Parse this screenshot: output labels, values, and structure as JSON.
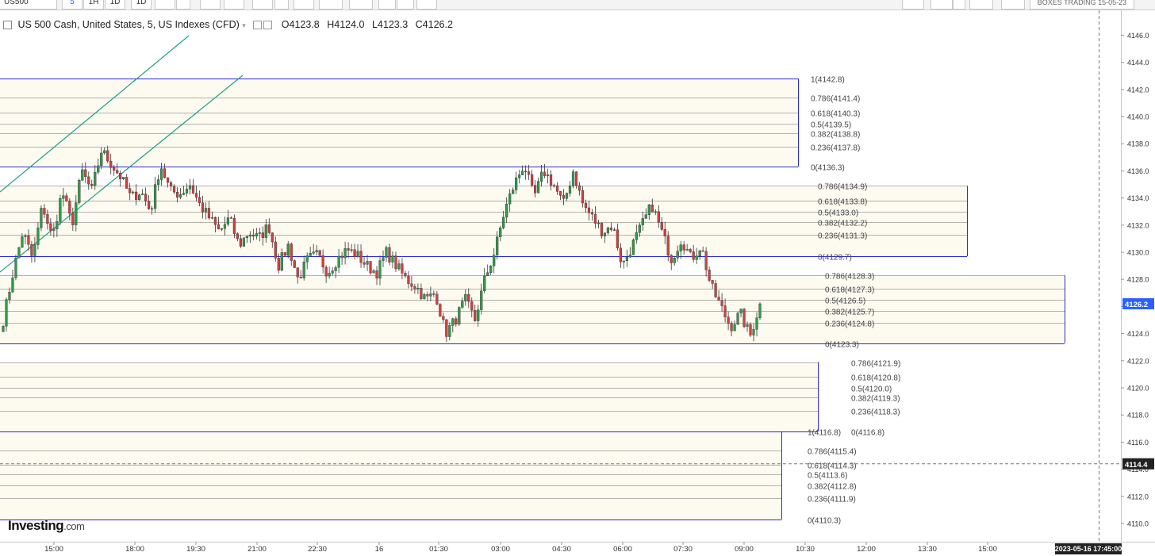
{
  "toolbar": {
    "symbol": "US500",
    "intervals": [
      "5",
      "1H",
      "1D",
      "1D"
    ],
    "right_label": "BOXES TRADING 15-05-23"
  },
  "legend": {
    "title": "US 500 Cash, United States, 5, US Indexes (CFD)",
    "open": "O4123.8",
    "high": "H4124.0",
    "low": "L4123.3",
    "close": "C4126.2"
  },
  "watermark": {
    "brand": "Investing",
    "suffix": ".com"
  },
  "colors": {
    "up": "#2e9b46",
    "down": "#d23f3f",
    "box_line": "#2b2bd1",
    "box_fill": "#fdfaf0",
    "fib_line": "#9a9a9a",
    "trend": "#1f9e8a",
    "price_label": "#2962ff"
  },
  "chart_data": {
    "type": "candlestick",
    "y_axis": {
      "min": 4110,
      "max": 4146,
      "ticks": [
        4110,
        4112,
        4114,
        4116,
        4118,
        4120,
        4122,
        4124,
        4126,
        4128,
        4130,
        4132,
        4134,
        4136,
        4138,
        4140,
        4142,
        4144,
        4146
      ]
    },
    "x_ticks": [
      "15:00",
      "18:00",
      "19:30",
      "21:00",
      "22:30",
      "16",
      "01:30",
      "03:00",
      "04:30",
      "06:00",
      "07:30",
      "09:00",
      "10:30",
      "12:00",
      "13:30",
      "15:00"
    ],
    "last_price": "4126.2",
    "crosshair_price": "4114.4",
    "crosshair_time": "2023-05-16 17:45:00",
    "fib_boxes": [
      {
        "levels": [
          {
            "ratio": "1",
            "price": "4142.8"
          },
          {
            "ratio": "0.786",
            "price": "4141.4"
          },
          {
            "ratio": "0.618",
            "price": "4140.3"
          },
          {
            "ratio": "0.5",
            "price": "4139.5"
          },
          {
            "ratio": "0.382",
            "price": "4138.8"
          },
          {
            "ratio": "0.236",
            "price": "4137.8"
          },
          {
            "ratio": "0",
            "price": "4136.3"
          }
        ]
      },
      {
        "levels": [
          {
            "ratio": "0.786",
            "price": "4134.9"
          },
          {
            "ratio": "0.618",
            "price": "4133.8"
          },
          {
            "ratio": "0.5",
            "price": "4133.0"
          },
          {
            "ratio": "0.382",
            "price": "4132.2"
          },
          {
            "ratio": "0.236",
            "price": "4131.3"
          },
          {
            "ratio": "0",
            "price": "4129.7"
          }
        ]
      },
      {
        "levels": [
          {
            "ratio": "0.786",
            "price": "4128.3"
          },
          {
            "ratio": "0.618",
            "price": "4127.3"
          },
          {
            "ratio": "0.5",
            "price": "4126.5"
          },
          {
            "ratio": "0.382",
            "price": "4125.7"
          },
          {
            "ratio": "0.236",
            "price": "4124.8"
          },
          {
            "ratio": "0",
            "price": "4123.3"
          }
        ]
      },
      {
        "levels": [
          {
            "ratio": "0.786",
            "price": "4121.9"
          },
          {
            "ratio": "0.618",
            "price": "4120.8"
          },
          {
            "ratio": "0.5",
            "price": "4120.0"
          },
          {
            "ratio": "0.382",
            "price": "4119.3"
          },
          {
            "ratio": "0.236",
            "price": "4118.3"
          },
          {
            "ratio": "0",
            "price": "4116.8"
          }
        ]
      },
      {
        "levels": [
          {
            "ratio": "1",
            "price": "4116.8"
          },
          {
            "ratio": "0.786",
            "price": "4115.4"
          },
          {
            "ratio": "0.618",
            "price": "4114.3"
          },
          {
            "ratio": "0.5",
            "price": "4113.6"
          },
          {
            "ratio": "0.382",
            "price": "4112.8"
          },
          {
            "ratio": "0.236",
            "price": "4111.9"
          },
          {
            "ratio": "0",
            "price": "4110.3"
          }
        ]
      }
    ],
    "anchors": [
      [
        4125.0,
        4128.5,
        4131.5,
        4129.5,
        4133.5,
        4131.0,
        4134.5,
        4132.0,
        4136.0,
        4134.5,
        4137.5,
        4136.5,
        4135.5,
        4134.0,
        4134.5,
        4133.0,
        4136.5,
        4134.5,
        4134.3,
        4135.0,
        4133.5,
        4132.5,
        4131.5,
        4132.5,
        4130.5,
        4131.5,
        4131.0,
        4132.0,
        4129.0,
        4130.5,
        4128.0,
        4129.5,
        4129.8,
        4128.5,
        4129.5,
        4130.2,
        4129.8,
        4129.0,
        4128.5,
        4130.0,
        4129.0,
        4128.0,
        4127.5,
        4126.5,
        4127.0,
        4124.0,
        4125.0,
        4126.5,
        4125.0,
        4128.0,
        4130.0,
        4133.0,
        4135.0,
        4136.5,
        4134.0,
        4136.0,
        4135.0,
        4133.5,
        4136.0,
        4133.5,
        4132.5,
        4131.5,
        4132.0,
        4129.0,
        4130.5,
        4132.0,
        4133.5,
        4131.5,
        4129.5,
        4131.0,
        4129.5,
        4130.5,
        4127.5,
        4126.0,
        4124.5,
        4125.5,
        4123.8,
        4126.2
      ]
    ]
  }
}
